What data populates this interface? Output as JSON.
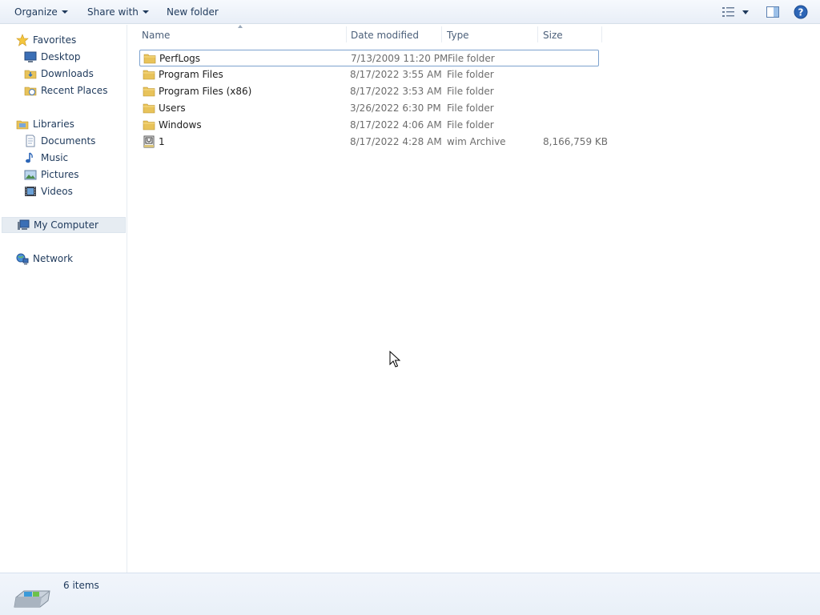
{
  "toolbar": {
    "organize_label": "Organize",
    "share_label": "Share with",
    "new_folder_label": "New folder"
  },
  "nav": {
    "favorites": {
      "label": "Favorites",
      "items": [
        {
          "label": "Desktop",
          "icon": "desktop-icon"
        },
        {
          "label": "Downloads",
          "icon": "downloads-icon"
        },
        {
          "label": "Recent Places",
          "icon": "recent-places-icon"
        }
      ]
    },
    "libraries": {
      "label": "Libraries",
      "items": [
        {
          "label": "Documents",
          "icon": "documents-icon"
        },
        {
          "label": "Music",
          "icon": "music-icon"
        },
        {
          "label": "Pictures",
          "icon": "pictures-icon"
        },
        {
          "label": "Videos",
          "icon": "videos-icon"
        }
      ]
    },
    "computer_label": "My Computer",
    "network_label": "Network"
  },
  "columns": {
    "name": "Name",
    "date": "Date modified",
    "type": "Type",
    "size": "Size"
  },
  "files": [
    {
      "name": "PerfLogs",
      "date": "7/13/2009 11:20 PM",
      "type": "File folder",
      "size": "",
      "icon": "folder-icon"
    },
    {
      "name": "Program Files",
      "date": "8/17/2022 3:55 AM",
      "type": "File folder",
      "size": "",
      "icon": "folder-icon"
    },
    {
      "name": "Program Files (x86)",
      "date": "8/17/2022 3:53 AM",
      "type": "File folder",
      "size": "",
      "icon": "folder-icon"
    },
    {
      "name": "Users",
      "date": "3/26/2022 6:30 PM",
      "type": "File folder",
      "size": "",
      "icon": "folder-icon"
    },
    {
      "name": "Windows",
      "date": "8/17/2022 4:06 AM",
      "type": "File folder",
      "size": "",
      "icon": "folder-icon"
    },
    {
      "name": "1",
      "date": "8/17/2022 4:28 AM",
      "type": "wim Archive",
      "size": "8,166,759 KB",
      "icon": "archive-file-icon"
    }
  ],
  "status": {
    "item_count": "6 items"
  },
  "colors": {
    "accent": "#1e395b",
    "folder": "#e8c35a",
    "selection_border": "#7da2ce"
  }
}
